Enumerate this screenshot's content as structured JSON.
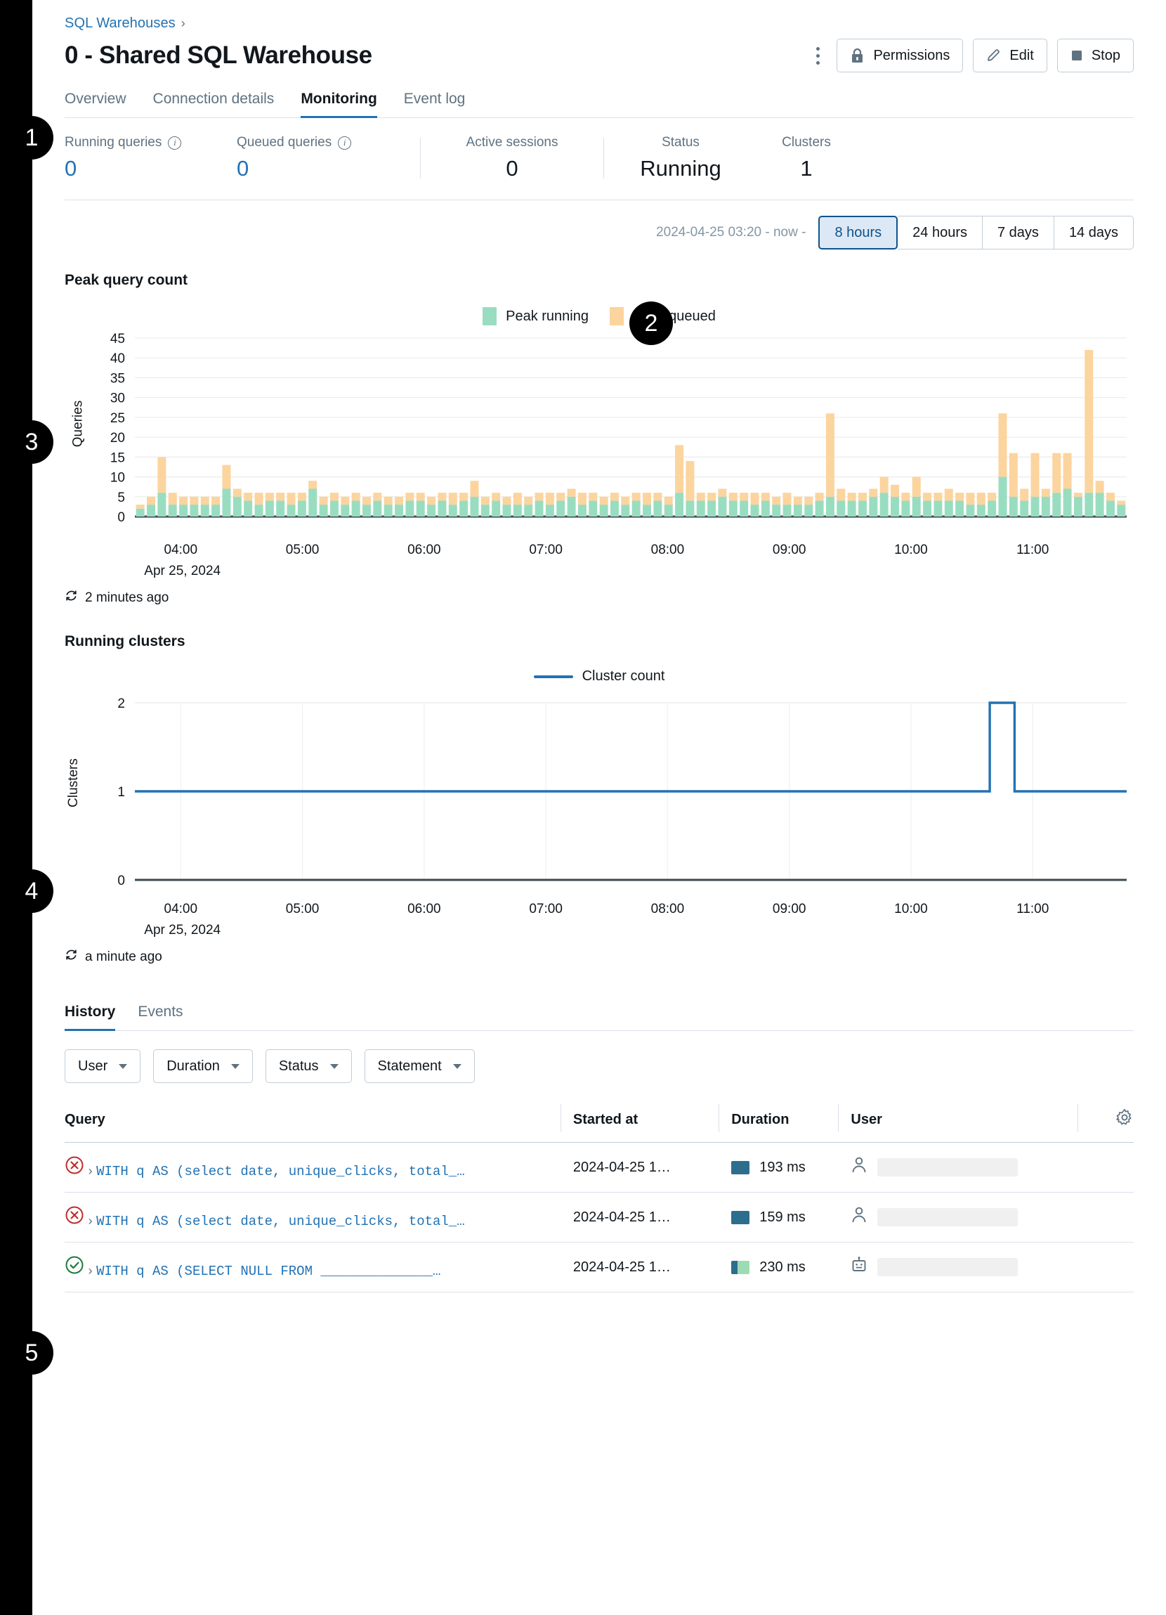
{
  "breadcrumb": {
    "parent": "SQL Warehouses",
    "separator": "›"
  },
  "header": {
    "title": "0 - Shared SQL Warehouse",
    "kebab_label": "more-options",
    "buttons": {
      "permissions": "Permissions",
      "edit": "Edit",
      "stop": "Stop"
    }
  },
  "tabs": [
    {
      "label": "Overview",
      "active": false
    },
    {
      "label": "Connection details",
      "active": false
    },
    {
      "label": "Monitoring",
      "active": true
    },
    {
      "label": "Event log",
      "active": false
    }
  ],
  "stats": [
    {
      "label": "Running queries",
      "value": "0",
      "info": true,
      "blue": true
    },
    {
      "label": "Queued queries",
      "value": "0",
      "info": true,
      "blue": true
    },
    {
      "label": "Active sessions",
      "value": "0",
      "info": false,
      "blue": false
    },
    {
      "label": "Status",
      "value": "Running",
      "info": false,
      "blue": false
    },
    {
      "label": "Clusters",
      "value": "1",
      "info": false,
      "blue": false
    }
  ],
  "timerange": {
    "text": "2024-04-25 03:20 - now -",
    "options": [
      {
        "label": "8 hours",
        "active": true
      },
      {
        "label": "24 hours",
        "active": false
      },
      {
        "label": "7 days",
        "active": false
      },
      {
        "label": "14 days",
        "active": false
      }
    ]
  },
  "peak_chart": {
    "title": "Peak query count",
    "refresh": "2 minutes ago",
    "refresh_icon": "refresh-icon"
  },
  "clusters_chart": {
    "title": "Running clusters",
    "refresh": "a minute ago",
    "refresh_icon": "refresh-icon"
  },
  "bottom_tabs": [
    {
      "label": "History",
      "active": true
    },
    {
      "label": "Events",
      "active": false
    }
  ],
  "filters": [
    {
      "label": "User"
    },
    {
      "label": "Duration"
    },
    {
      "label": "Status"
    },
    {
      "label": "Statement"
    }
  ],
  "table": {
    "columns": [
      "Query",
      "Started at",
      "Duration",
      "User"
    ],
    "settings_icon": "gear-icon",
    "rows": [
      {
        "status": "error",
        "query": "WITH q AS (select date, unique_clicks, total_…",
        "started_at": "2024-04-25 1…",
        "duration": "193 ms",
        "duration_color": "#2D6E8E",
        "duration_color2": "#2D6E8E",
        "user_icon": "person-icon",
        "user": ""
      },
      {
        "status": "error",
        "query": "WITH q AS (select date, unique_clicks, total_…",
        "started_at": "2024-04-25 1…",
        "duration": "159 ms",
        "duration_color": "#2D6E8E",
        "duration_color2": "#2D6E8E",
        "user_icon": "person-icon",
        "user": ""
      },
      {
        "status": "success",
        "query": "WITH q AS (SELECT NULL FROM ______________…",
        "started_at": "2024-04-25 1…",
        "duration": "230 ms",
        "duration_color": "#2D6E8E",
        "duration_color2": "#9CDCB4",
        "user_icon": "robot-icon",
        "user": ""
      }
    ]
  },
  "badges": [
    "1",
    "2",
    "3",
    "4",
    "5"
  ],
  "colors": {
    "peak_running": "#99DDC0",
    "peak_queued": "#FCD49E",
    "cluster_line": "#2272B4",
    "link": "#2272B4",
    "muted": "#5F7281",
    "border": "#DCE0EA"
  },
  "chart_data": [
    {
      "type": "bar",
      "title": "Peak query count",
      "stacked": true,
      "xlabel": "",
      "ylabel": "Queries",
      "ylim": [
        0,
        45
      ],
      "yticks": [
        0,
        5,
        10,
        15,
        20,
        25,
        30,
        35,
        40,
        45
      ],
      "grid": true,
      "legend": [
        "Peak running",
        "Peak queued"
      ],
      "legend_position": "top-center",
      "xticks": [
        "04:00",
        "05:00",
        "06:00",
        "07:00",
        "08:00",
        "09:00",
        "10:00",
        "11:00"
      ],
      "xaxis_date": "Apr 25, 2024",
      "xaxis_range": "2024-04-25 03:20 - 2024-04-25 11:20",
      "series": [
        {
          "name": "Peak running",
          "color": "#99DDC0",
          "values": [
            2,
            3,
            6,
            3,
            3,
            3,
            3,
            3,
            7,
            5,
            4,
            3,
            4,
            4,
            3,
            4,
            7,
            3,
            4,
            3,
            4,
            3,
            4,
            3,
            3,
            4,
            4,
            3,
            4,
            3,
            4,
            5,
            3,
            4,
            3,
            3,
            3,
            4,
            3,
            4,
            5,
            3,
            4,
            3,
            4,
            3,
            4,
            3,
            4,
            3,
            6,
            4,
            4,
            4,
            5,
            4,
            4,
            3,
            4,
            3,
            3,
            3,
            3,
            4,
            5,
            4,
            4,
            4,
            5,
            6,
            5,
            4,
            5,
            4,
            4,
            4,
            4,
            3,
            3,
            4,
            10,
            5,
            4,
            5,
            5,
            6,
            7,
            5,
            6,
            6,
            4,
            3
          ]
        },
        {
          "name": "Peak queued",
          "color": "#FCD49E",
          "values": [
            1,
            2,
            9,
            3,
            2,
            2,
            2,
            2,
            6,
            2,
            2,
            3,
            2,
            2,
            3,
            2,
            2,
            2,
            2,
            2,
            2,
            2,
            2,
            2,
            2,
            2,
            2,
            2,
            2,
            3,
            2,
            4,
            2,
            2,
            2,
            3,
            2,
            2,
            3,
            2,
            2,
            3,
            2,
            2,
            2,
            2,
            2,
            3,
            2,
            2,
            12,
            10,
            2,
            2,
            2,
            2,
            2,
            3,
            2,
            2,
            3,
            2,
            2,
            2,
            21,
            3,
            2,
            2,
            2,
            4,
            3,
            2,
            5,
            2,
            2,
            3,
            2,
            3,
            3,
            2,
            16,
            11,
            3,
            11,
            2,
            10,
            9,
            1,
            36,
            3,
            2,
            1
          ]
        }
      ]
    },
    {
      "type": "line",
      "title": "Running clusters",
      "xlabel": "",
      "ylabel": "Clusters",
      "ylim": [
        0,
        2
      ],
      "yticks": [
        0,
        1,
        2
      ],
      "grid": true,
      "legend": [
        "Cluster count"
      ],
      "legend_position": "top-center",
      "xticks": [
        "04:00",
        "05:00",
        "06:00",
        "07:00",
        "08:00",
        "09:00",
        "10:00",
        "11:00"
      ],
      "xaxis_date": "Apr 25, 2024",
      "series": [
        {
          "name": "Cluster count",
          "color": "#2272B4",
          "points": [
            {
              "x": 0.0,
              "y": 1
            },
            {
              "x": 0.862,
              "y": 1
            },
            {
              "x": 0.862,
              "y": 2
            },
            {
              "x": 0.887,
              "y": 2
            },
            {
              "x": 0.887,
              "y": 1
            },
            {
              "x": 1.0,
              "y": 1
            }
          ]
        }
      ]
    }
  ]
}
